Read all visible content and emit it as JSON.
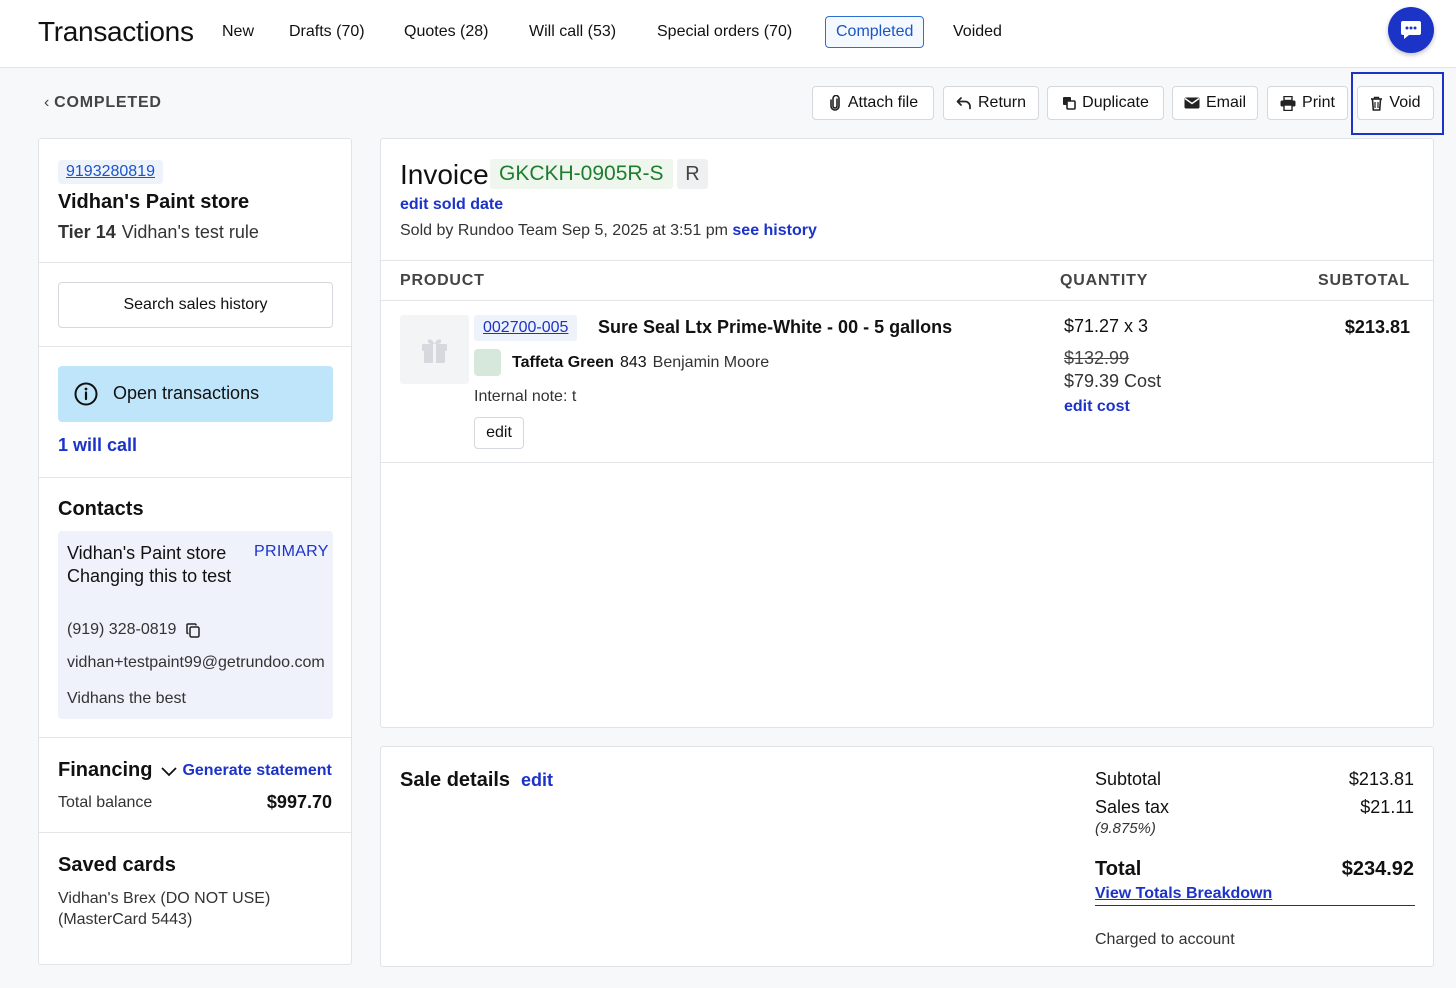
{
  "header": {
    "title": "Transactions",
    "tabs": [
      {
        "label": "New"
      },
      {
        "label": "Drafts (70)"
      },
      {
        "label": "Quotes (28)"
      },
      {
        "label": "Will call (53)"
      },
      {
        "label": "Special orders (70)"
      },
      {
        "label": "Completed"
      },
      {
        "label": "Voided"
      }
    ],
    "active_tab": "Completed"
  },
  "breadcrumb": {
    "back_label": "COMPLETED"
  },
  "actions": {
    "attach": "Attach file",
    "return": "Return",
    "duplicate": "Duplicate",
    "email": "Email",
    "print": "Print",
    "void": "Void"
  },
  "customer": {
    "phone_id": "9193280819",
    "name": "Vidhan's Paint store",
    "tier": "Tier 14",
    "rule": "Vidhan's test rule",
    "search_label": "Search sales history",
    "open_tx_label": "Open transactions",
    "will_call_link": "1 will call"
  },
  "contacts": {
    "title": "Contacts",
    "name": "Vidhan's Paint store Changing this to test",
    "badge": "PRIMARY",
    "phone": "(919) 328-0819",
    "email": "vidhan+testpaint99@getrundoo.com",
    "note": "Vidhans the best"
  },
  "financing": {
    "title": "Financing",
    "generate_label": "Generate statement",
    "balance_label": "Total balance",
    "balance_value": "$997.70"
  },
  "saved_cards": {
    "title": "Saved cards",
    "card": "Vidhan's Brex (DO NOT USE) (MasterCard 5443)"
  },
  "invoice": {
    "label": "Invoice",
    "number": "GKCKH-0905R-S",
    "flag": "R",
    "edit_sold_date": "edit sold date",
    "sold_by": "Sold by Rundoo Team Sep 5, 2025 at 3:51 pm",
    "see_history": "see history",
    "columns": {
      "product": "PRODUCT",
      "quantity": "QUANTITY",
      "subtotal": "SUBTOTAL"
    },
    "line": {
      "sku": "002700-005",
      "name": "Sure Seal Ltx Prime-White - 00 - 5 gallons",
      "color_name": "Taffeta Green",
      "color_code": "843",
      "brand": "Benjamin Moore",
      "swatch_color": "#d6e8dc",
      "internal_note": "Internal note: t",
      "edit_label": "edit",
      "qty": "$71.27 x 3",
      "original_price": "$132.99",
      "cost": "$79.39 Cost",
      "edit_cost": "edit cost",
      "subtotal": "$213.81"
    }
  },
  "sale_details": {
    "title": "Sale details",
    "edit_label": "edit",
    "subtotal_label": "Subtotal",
    "subtotal_value": "$213.81",
    "tax_label": "Sales tax",
    "tax_rate": "(9.875%)",
    "tax_value": "$21.11",
    "total_label": "Total",
    "total_value": "$234.92",
    "breakdown_label": "View Totals Breakdown",
    "charged": "Charged to account"
  },
  "colors": {
    "link": "#1c33c8",
    "active_tab": "#2f6fd6",
    "invoice_green": "#1e7d2e",
    "open_tx_bg": "#bfe5fb"
  },
  "icons": {
    "chat": "chat-bubble-icon",
    "attach": "paperclip-icon",
    "return": "undo-arrow-icon",
    "duplicate": "copy-icon",
    "email": "envelope-icon",
    "print": "printer-icon",
    "void": "trash-icon",
    "info": "info-circle-icon",
    "copy_phone": "copy-icon",
    "product_placeholder": "gift-icon"
  }
}
